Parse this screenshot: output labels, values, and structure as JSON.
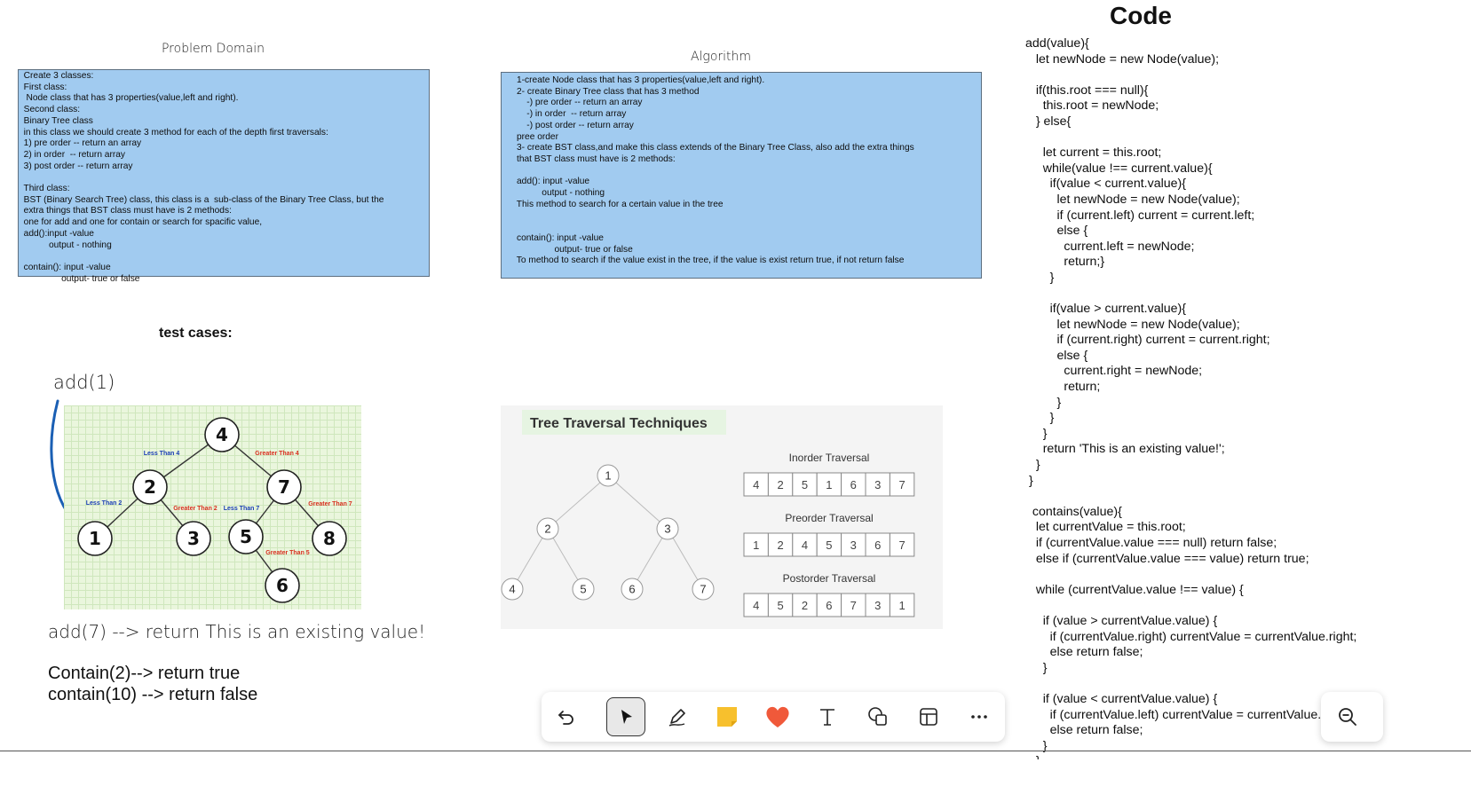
{
  "problem_domain": {
    "title": "Problem Domain",
    "text": "  Create 3 classes:\n  First class:\n   Node class that has 3 properties(value,left and right).\n  Second class:\n  Binary Tree class\n  in this class we should create 3 method for each of the depth first traversals:\n  1) pre order -- return an array\n  2) in order  -- return array\n  3) post order -- return array\n\n  Third class:\n  BST (Binary Search Tree) class, this class is a  sub-class of the Binary Tree Class, but the\n  extra things that BST class must have is 2 methods:\n  one for add and one for contain or search for spacific value,\n  add():input -value\n            output - nothing\n\n  contain(): input -value\n                 output- true or false"
  },
  "algorithm": {
    "title": "Algorithm",
    "text": "      1-create Node class that has 3 properties(value,left and right).\n      2- create Binary Tree class that has 3 method\n          -) pre order -- return an array\n          -) in order  -- return array\n          -) post order -- return array\n      pree order\n      3- create BST class,and make this class extends of the Binary Tree Class, also add the extra things\n      that BST class must have is 2 methods:\n\n      add(): input -value\n                output - nothing\n      This method to search for a certain value in the tree\n\n\n      contain(): input -value\n                     output- true or false\n      To method to search if the value exist in the tree, if the value is exist return true, if not return false"
  },
  "test_cases": {
    "title": "test cases:",
    "add1": "add(1)",
    "add7": "add(7)  --> return This is an existing value!",
    "contain2": "Contain(2)-->  return true",
    "contain10": "contain(10) --> return false"
  },
  "bst_image": {
    "nodes": [
      "4",
      "2",
      "7",
      "1",
      "3",
      "5",
      "8",
      "6"
    ],
    "edge_labels": [
      "Less Than 4",
      "Greater Than 4",
      "Less Than 2",
      "Greater Than 2",
      "Less Than 7",
      "Greater Than 7",
      "Greater Than 5"
    ]
  },
  "traversal_image": {
    "title": "Tree Traversal Techniques",
    "tree_nodes": [
      "1",
      "2",
      "3",
      "4",
      "5",
      "6",
      "7"
    ],
    "inorder": {
      "label": "Inorder Traversal",
      "values": [
        "4",
        "2",
        "5",
        "1",
        "6",
        "3",
        "7"
      ]
    },
    "preorder": {
      "label": "Preorder Traversal",
      "values": [
        "1",
        "2",
        "4",
        "5",
        "3",
        "6",
        "7"
      ]
    },
    "postorder": {
      "label": "Postorder Traversal",
      "values": [
        "4",
        "5",
        "2",
        "6",
        "7",
        "3",
        "1"
      ]
    }
  },
  "code": {
    "title": "Code",
    "text": "add(value){\n   let newNode = new Node(value);\n\n   if(this.root === null){\n     this.root = newNode;\n   } else{\n\n     let current = this.root;\n     while(value !== current.value){\n       if(value < current.value){\n         let newNode = new Node(value);\n         if (current.left) current = current.left;\n         else {\n           current.left = newNode;\n           return;}\n       }\n\n       if(value > current.value){\n         let newNode = new Node(value);\n         if (current.right) current = current.right;\n         else {\n           current.right = newNode;\n           return;\n         }\n       }\n     }\n     return 'This is an existing value!';\n   }\n }\n\n  contains(value){\n   let currentValue = this.root;\n   if (currentValue.value === null) return false;\n   else if (currentValue.value === value) return true;\n\n   while (currentValue.value !== value) {\n\n     if (value > currentValue.value) {\n       if (currentValue.right) currentValue = currentValue.right;\n       else return false;\n     }\n\n     if (value < currentValue.value) {\n       if (currentValue.left) currentValue = currentValue.left;\n       else return false;\n     }\n   }\n   return true;"
  },
  "toolbar": {
    "tools": [
      "undo-icon",
      "select-pointer-icon",
      "pen-icon",
      "sticky-note-icon",
      "reaction-heart-icon",
      "text-icon",
      "shapes-icon",
      "template-icon",
      "more-icon"
    ],
    "active": "select-pointer-icon"
  },
  "zoom_control": {
    "icon": "zoom-out-icon"
  },
  "colors": {
    "box_fill": "#a1cbf0",
    "note_yellow": "#f7c02d",
    "heart_red": "#f0593a",
    "arrow_blue": "#1a5fb4",
    "grid_green": "#eaf6dd"
  }
}
